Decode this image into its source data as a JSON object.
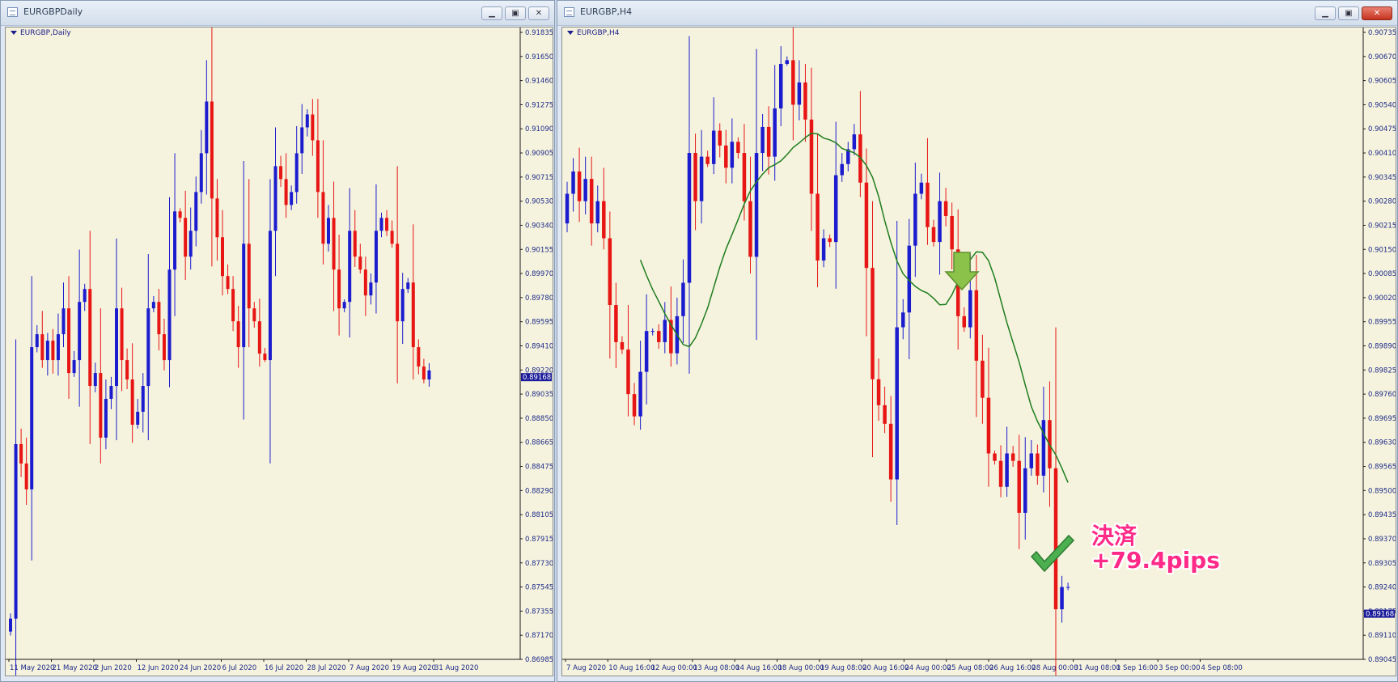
{
  "windows": [
    {
      "title": "EURGBPDaily",
      "chart_label": "EURGBP,Daily",
      "current_price": "0.89168",
      "price_ticks": [
        "0.91835",
        "0.91650",
        "0.91460",
        "0.91275",
        "0.91090",
        "0.90905",
        "0.90715",
        "0.90530",
        "0.90340",
        "0.90155",
        "0.89970",
        "0.89780",
        "0.89595",
        "0.89410",
        "0.89220",
        "0.89035",
        "0.88850",
        "0.88665",
        "0.88475",
        "0.88290",
        "0.88105",
        "0.87915",
        "0.87730",
        "0.87545",
        "0.87355",
        "0.87170",
        "0.86985"
      ],
      "time_ticks": [
        "11 May 2020",
        "21 May 2020",
        "2 Jun 2020",
        "12 Jun 2020",
        "24 Jun 2020",
        "6 Jul 2020",
        "16 Jul 2020",
        "28 Jul 2020",
        "7 Aug 2020",
        "19 Aug 2020",
        "31 Aug 2020"
      ]
    },
    {
      "title": "EURGBP,H4",
      "chart_label": "EURGBP,H4",
      "current_price": "0.89168",
      "price_ticks": [
        "0.90735",
        "0.90670",
        "0.90605",
        "0.90540",
        "0.90475",
        "0.90410",
        "0.90345",
        "0.90280",
        "0.90215",
        "0.90150",
        "0.90085",
        "0.90020",
        "0.89955",
        "0.89890",
        "0.89825",
        "0.89760",
        "0.89695",
        "0.89630",
        "0.89565",
        "0.89500",
        "0.89435",
        "0.89370",
        "0.89305",
        "0.89240",
        "0.89175",
        "0.89110",
        "0.89045"
      ],
      "time_ticks": [
        "7 Aug 2020",
        "10 Aug 16:00",
        "12 Aug 00:00",
        "13 Aug 08:00",
        "14 Aug 16:00",
        "18 Aug 00:00",
        "19 Aug 08:00",
        "20 Aug 16:00",
        "24 Aug 00:00",
        "25 Aug 08:00",
        "26 Aug 16:00",
        "28 Aug 00:00",
        "31 Aug 08:00",
        "1 Sep 16:00",
        "3 Sep 00:00",
        "4 Sep 08:00"
      ]
    }
  ],
  "annotation": {
    "line1": "決済",
    "line2": "+79.4pips"
  },
  "colors": {
    "bull": "#1c1ccf",
    "bear": "#e81515",
    "ma": "#1f7d1f",
    "background": "#f5f3dd",
    "arrow": "#8bc34a",
    "check": "#4caf50",
    "annotation": "#ff2a88"
  },
  "chart_data": [
    {
      "type": "candlestick",
      "title": "EURGBP,Daily",
      "y_range": [
        0.86985,
        0.91835
      ],
      "x_ticks": [
        "11 May 2020",
        "21 May 2020",
        "2 Jun 2020",
        "12 Jun 2020",
        "24 Jun 2020",
        "6 Jul 2020",
        "16 Jul 2020",
        "28 Jul 2020",
        "7 Aug 2020",
        "19 Aug 2020",
        "31 Aug 2020"
      ],
      "current_price": 0.89168,
      "candles_close": [
        0.873,
        0.8865,
        0.885,
        0.883,
        0.894,
        0.895,
        0.893,
        0.8945,
        0.893,
        0.895,
        0.897,
        0.892,
        0.893,
        0.8975,
        0.8985,
        0.891,
        0.892,
        0.887,
        0.89,
        0.891,
        0.897,
        0.893,
        0.8915,
        0.888,
        0.889,
        0.891,
        0.897,
        0.8975,
        0.895,
        0.893,
        0.9,
        0.9045,
        0.904,
        0.901,
        0.903,
        0.906,
        0.909,
        0.913,
        0.9055,
        0.9025,
        0.8995,
        0.8985,
        0.896,
        0.894,
        0.902,
        0.897,
        0.896,
        0.8935,
        0.893,
        0.903,
        0.908,
        0.907,
        0.905,
        0.906,
        0.909,
        0.911,
        0.912,
        0.91,
        0.906,
        0.902,
        0.904,
        0.9,
        0.897,
        0.8975,
        0.903,
        0.901,
        0.9,
        0.898,
        0.899,
        0.903,
        0.904,
        0.903,
        0.902,
        0.896,
        0.8985,
        0.899,
        0.894,
        0.8925,
        0.8915,
        0.8922
      ]
    },
    {
      "type": "candlestick",
      "title": "EURGBP,H4",
      "y_range": [
        0.89045,
        0.90735
      ],
      "x_ticks": [
        "7 Aug 2020",
        "10 Aug 16:00",
        "12 Aug 00:00",
        "13 Aug 08:00",
        "14 Aug 16:00",
        "18 Aug 00:00",
        "19 Aug 08:00",
        "20 Aug 16:00",
        "24 Aug 00:00",
        "25 Aug 08:00",
        "26 Aug 16:00",
        "28 Aug 00:00",
        "31 Aug 08:00",
        "1 Sep 16:00",
        "3 Sep 00:00",
        "4 Sep 08:00"
      ],
      "current_price": 0.89168,
      "indicator": "moving average",
      "candles_close": [
        0.903,
        0.9036,
        0.9028,
        0.9034,
        0.9022,
        0.9028,
        0.9018,
        0.9,
        0.899,
        0.8988,
        0.8976,
        0.897,
        0.8982,
        0.8993,
        0.8993,
        0.899,
        0.8996,
        0.8987,
        0.8997,
        0.9006,
        0.9041,
        0.9028,
        0.904,
        0.9038,
        0.9047,
        0.9043,
        0.9037,
        0.9044,
        0.9041,
        0.9028,
        0.9013,
        0.9041,
        0.9048,
        0.904,
        0.9053,
        0.9065,
        0.9066,
        0.9054,
        0.906,
        0.905,
        0.903,
        0.9012,
        0.9018,
        0.9017,
        0.9035,
        0.9038,
        0.9042,
        0.9046,
        0.9033,
        0.901,
        0.898,
        0.8973,
        0.8968,
        0.8953,
        0.8994,
        0.8998,
        0.9016,
        0.903,
        0.9033,
        0.9021,
        0.9017,
        0.9028,
        0.9024,
        0.9015,
        0.8997,
        0.8994,
        0.9004,
        0.8985,
        0.8975,
        0.896,
        0.8958,
        0.8951,
        0.896,
        0.8958,
        0.8944,
        0.8956,
        0.896,
        0.8954,
        0.8969,
        0.8956,
        0.8918,
        0.8924,
        0.8924
      ]
    }
  ]
}
